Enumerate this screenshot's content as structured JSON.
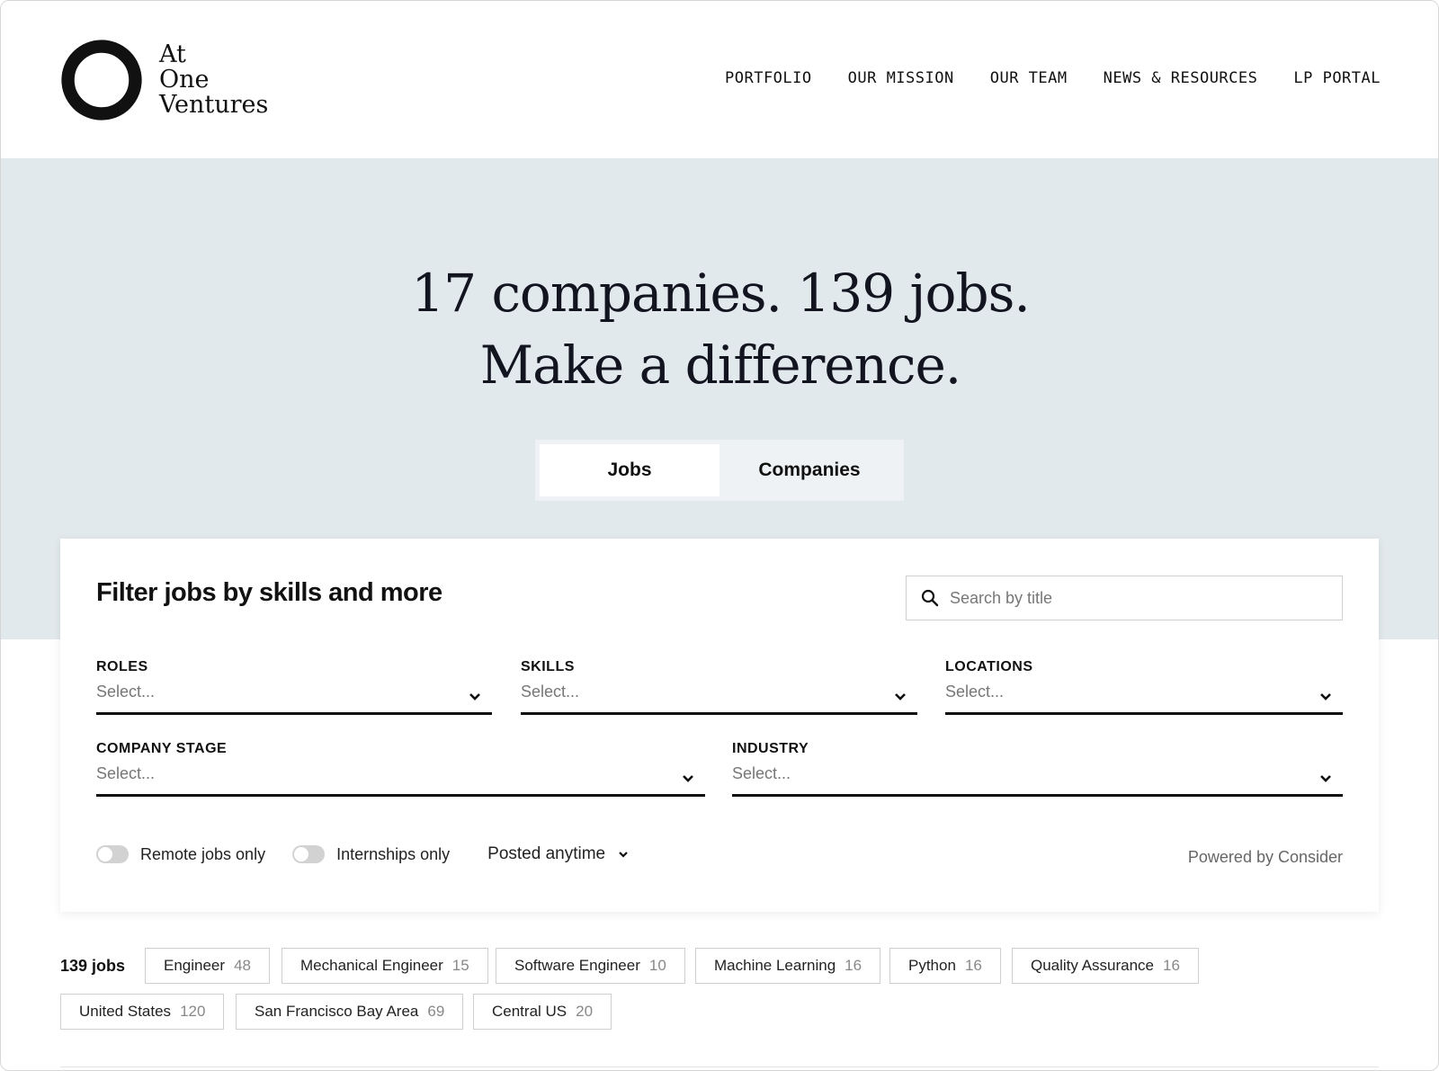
{
  "brand": {
    "line1": "At",
    "line2": "One",
    "line3": "Ventures"
  },
  "nav": [
    "PORTFOLIO",
    "OUR MISSION",
    "OUR TEAM",
    "NEWS & RESOURCES",
    "LP PORTAL"
  ],
  "hero": {
    "line1": "17 companies. 139 jobs.",
    "line2": "Make a difference."
  },
  "tabs": [
    {
      "label": "Jobs",
      "active": true
    },
    {
      "label": "Companies",
      "active": false
    }
  ],
  "filter": {
    "title": "Filter jobs by skills and more",
    "search_placeholder": "Search by title",
    "fields": {
      "roles": {
        "label": "ROLES",
        "value": "Select..."
      },
      "skills": {
        "label": "SKILLS",
        "value": "Select..."
      },
      "locations": {
        "label": "LOCATIONS",
        "value": "Select..."
      },
      "company_stage": {
        "label": "COMPANY STAGE",
        "value": "Select..."
      },
      "industry": {
        "label": "INDUSTRY",
        "value": "Select..."
      }
    },
    "remote_label": "Remote jobs only",
    "internships_label": "Internships only",
    "posted_label": "Posted anytime",
    "powered_by": "Powered by Consider"
  },
  "results": {
    "count_label": "139 jobs",
    "chips": [
      {
        "label": "Engineer",
        "count": "48"
      },
      {
        "label": "Mechanical Engineer",
        "count": "15"
      },
      {
        "label": "Software Engineer",
        "count": "10"
      },
      {
        "label": "Machine Learning",
        "count": "16"
      },
      {
        "label": "Python",
        "count": "16"
      },
      {
        "label": "Quality Assurance",
        "count": "16"
      },
      {
        "label": "United States",
        "count": "120"
      },
      {
        "label": "San Francisco Bay Area",
        "count": "69"
      },
      {
        "label": "Central US",
        "count": "20"
      }
    ]
  },
  "colors": {
    "hero_bg": "#e2e9ec",
    "text": "#111111",
    "muted": "#777777"
  }
}
